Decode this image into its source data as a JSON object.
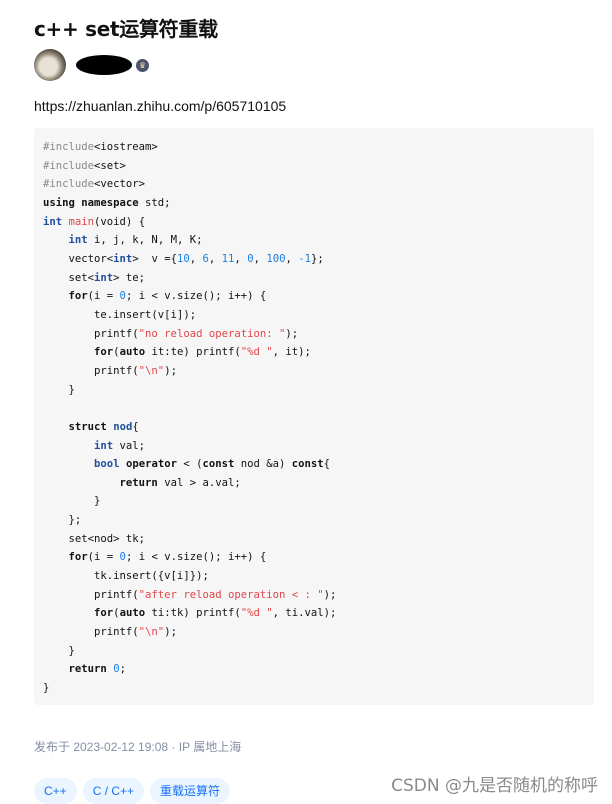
{
  "article": {
    "title": "c++ set运算符重载",
    "link": "https://zhuanlan.zhihu.com/p/605710105",
    "meta": "发布于 2023-02-12 19:08 · IP 属地上海",
    "tags": [
      "C++",
      "C / C++",
      "重载运算符"
    ]
  },
  "author": {
    "avatar_icon": "avatar-image",
    "badge_icon": "crown-badge-icon"
  },
  "watermark": "CSDN @九是否随机的称呼",
  "colors": {
    "keyword": "#121212",
    "type": "#1f4f9a",
    "string": "#e0474a",
    "number": "#1b7fe0",
    "preprocessor": "#8a8a8a",
    "tag_bg": "#ebf5ff",
    "tag_text": "#1772f6"
  },
  "code": [
    [
      [
        "p",
        "#include"
      ],
      "<iostream>"
    ],
    [
      [
        "p",
        "#include"
      ],
      "<set>"
    ],
    [
      [
        "p",
        "#include"
      ],
      "<vector>"
    ],
    [
      [
        "k",
        "using namespace"
      ],
      " std;"
    ],
    [
      [
        "t",
        "int"
      ],
      " ",
      [
        "f",
        "main"
      ],
      "(void) {"
    ],
    [
      "    ",
      [
        "t",
        "int"
      ],
      " i, j, k, N, M, K;"
    ],
    [
      "    vector<",
      [
        "t",
        "int"
      ],
      ">  v ={",
      [
        "n",
        "10"
      ],
      ", ",
      [
        "n",
        "6"
      ],
      ", ",
      [
        "n",
        "11"
      ],
      ", ",
      [
        "n",
        "0"
      ],
      ", ",
      [
        "n",
        "100"
      ],
      ", ",
      [
        "n",
        "-1"
      ],
      "};"
    ],
    [
      "    set<",
      [
        "t",
        "int"
      ],
      "> te;"
    ],
    [
      "    ",
      [
        "k",
        "for"
      ],
      "(i = ",
      [
        "n",
        "0"
      ],
      "; i < v.size(); i++) {"
    ],
    [
      "        te.insert(v[i]);"
    ],
    [
      "        printf(",
      [
        "s",
        "\"no reload operation: \""
      ],
      ");"
    ],
    [
      "        ",
      [
        "k",
        "for"
      ],
      "(",
      [
        "k",
        "auto"
      ],
      " it:te) printf(",
      [
        "s",
        "\"%d \""
      ],
      ", it);"
    ],
    [
      "        printf(",
      [
        "s",
        "\"\\n\""
      ],
      ");"
    ],
    [
      "    }"
    ],
    [
      ""
    ],
    [
      "    ",
      [
        "k",
        "struct"
      ],
      " ",
      [
        "t",
        "nod"
      ],
      "{"
    ],
    [
      "        ",
      [
        "t",
        "int"
      ],
      " val;"
    ],
    [
      "        ",
      [
        "t",
        "bool"
      ],
      " ",
      [
        "k",
        "operator"
      ],
      " < (",
      [
        "k",
        "const"
      ],
      " nod &a) ",
      [
        "k",
        "const"
      ],
      "{"
    ],
    [
      "            ",
      [
        "k",
        "return"
      ],
      " val > a.val;"
    ],
    [
      "        }"
    ],
    [
      "    };"
    ],
    [
      "    set<nod> tk;"
    ],
    [
      "    ",
      [
        "k",
        "for"
      ],
      "(i = ",
      [
        "n",
        "0"
      ],
      "; i < v.size(); i++) {"
    ],
    [
      "        tk.insert({v[i]});"
    ],
    [
      "        printf(",
      [
        "s",
        "\"after reload operation < : \""
      ],
      ");"
    ],
    [
      "        ",
      [
        "k",
        "for"
      ],
      "(",
      [
        "k",
        "auto"
      ],
      " ti:tk) printf(",
      [
        "s",
        "\"%d \""
      ],
      ", ti.val);"
    ],
    [
      "        printf(",
      [
        "s",
        "\"\\n\""
      ],
      ");"
    ],
    [
      "    }"
    ],
    [
      "    ",
      [
        "k",
        "return"
      ],
      " ",
      [
        "n",
        "0"
      ],
      ";"
    ],
    [
      "}"
    ]
  ]
}
